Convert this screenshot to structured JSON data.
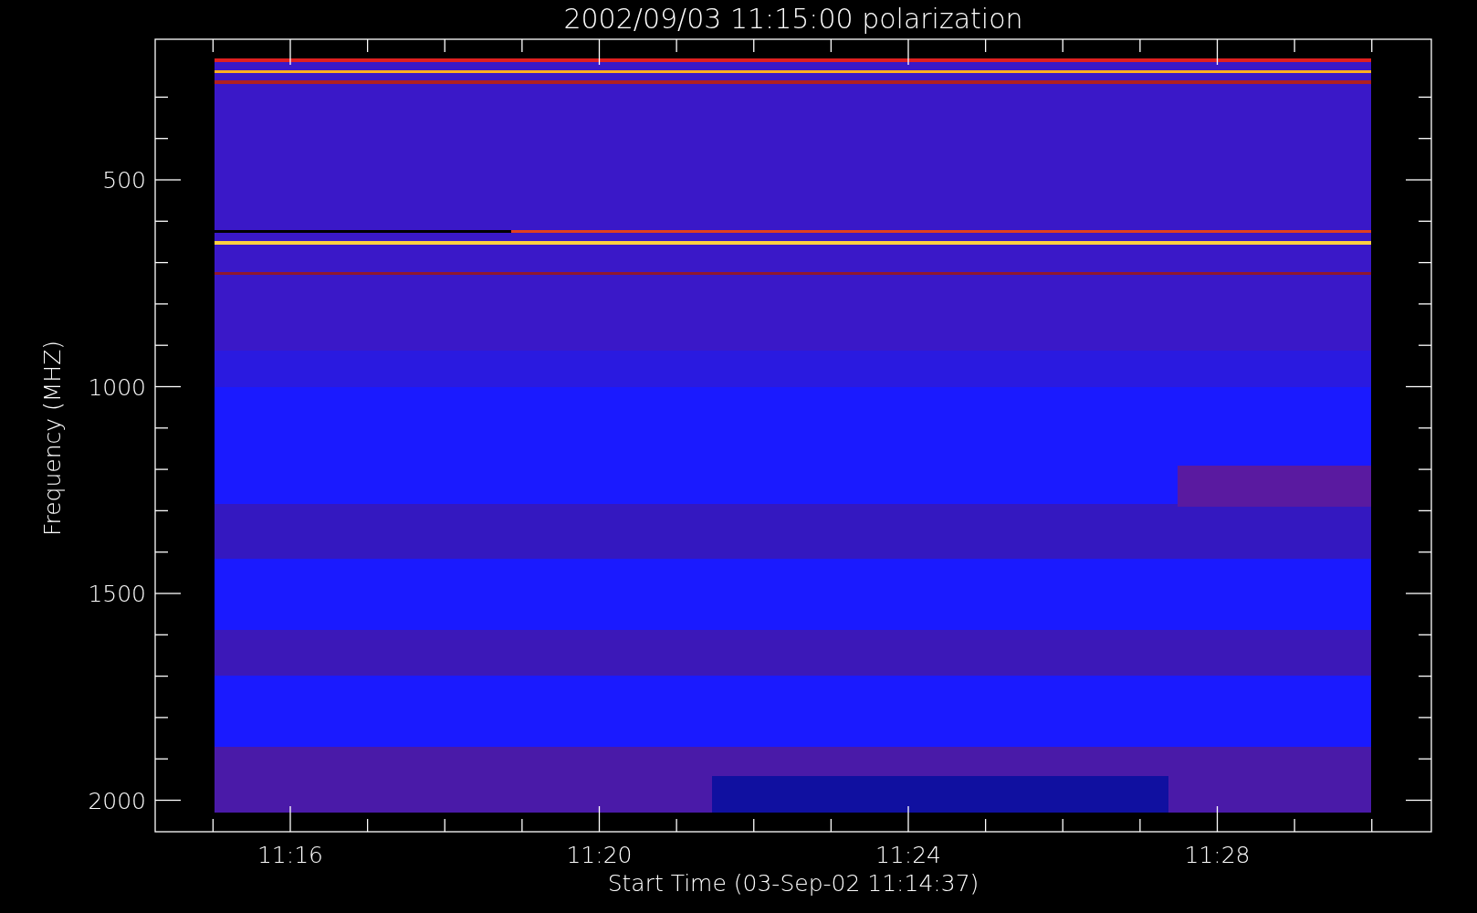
{
  "title": "2002/09/03 11:15:00 polarization",
  "y_axis": {
    "label": "Frequency (MHZ)",
    "ticks": [
      "500",
      "1000",
      "1500",
      "2000"
    ]
  },
  "x_axis": {
    "label": "Start Time (03-Sep-02 11:14:37)",
    "ticks": [
      "11:16",
      "11:20",
      "11:24",
      "11:28"
    ]
  }
}
